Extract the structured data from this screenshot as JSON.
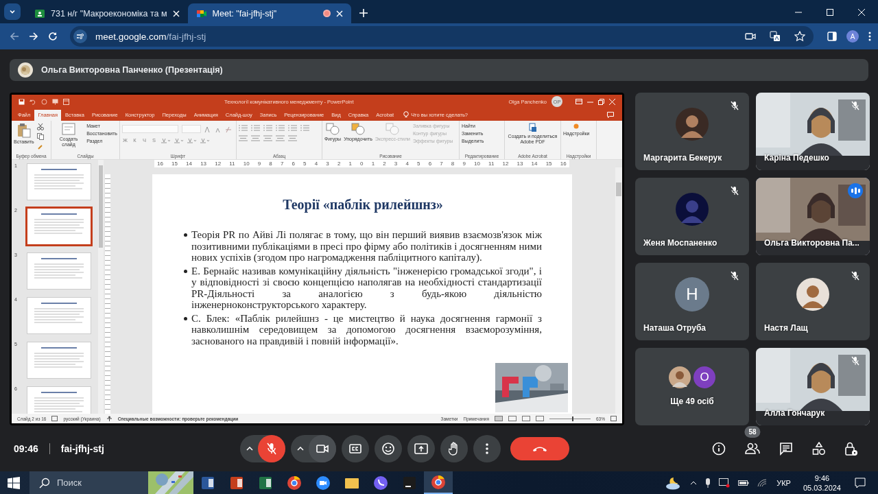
{
  "browser": {
    "tabs": [
      {
        "title": "731 н/г \"Макроекономіка та м",
        "kind": "classroom",
        "selected": false,
        "recording": false
      },
      {
        "title": "Meet: \"fai-jfhj-stj\"",
        "kind": "meet",
        "selected": true,
        "recording": true
      }
    ],
    "address": {
      "host": "meet.google.com",
      "path": "/fai-jfhj-stj"
    },
    "profile": "A"
  },
  "presenter": {
    "name": "Ольга Викторовна Панченко (Презентація)"
  },
  "powerpoint": {
    "title": "Технології комунікативного менеджменту - PowerPoint",
    "user": "Olga Panchenko",
    "user_initials": "OP",
    "tabs": [
      {
        "label": "Файл",
        "selected": false
      },
      {
        "label": "Главная",
        "selected": true
      },
      {
        "label": "Вставка",
        "selected": false
      },
      {
        "label": "Рисование",
        "selected": false
      },
      {
        "label": "Конструктор",
        "selected": false
      },
      {
        "label": "Переходы",
        "selected": false
      },
      {
        "label": "Анимация",
        "selected": false
      },
      {
        "label": "Слайд-шоу",
        "selected": false
      },
      {
        "label": "Запись",
        "selected": false
      },
      {
        "label": "Рецензирование",
        "selected": false
      },
      {
        "label": "Вид",
        "selected": false
      },
      {
        "label": "Справка",
        "selected": false
      },
      {
        "label": "Acrobat",
        "selected": false
      }
    ],
    "tell_me": "Что вы хотите сделать?",
    "clipboard": {
      "label": "Буфер обмена",
      "paste": "Вставить"
    },
    "slides": {
      "label": "Слайды",
      "new_slide": "Создать слайд",
      "items": [
        "Макет",
        "Восстановить",
        "Раздел"
      ]
    },
    "font": {
      "label": "Шрифт",
      "buttons": [
        "Ж",
        "К",
        "Ч",
        "S"
      ]
    },
    "paragraph": {
      "label": "Абзац"
    },
    "drawing": {
      "label": "Рисование",
      "big": [
        {
          "label": "Фигуры",
          "disabled": false
        },
        {
          "label": "Упорядочить",
          "disabled": false
        },
        {
          "label": "Экспресс-стили",
          "disabled": true
        }
      ],
      "items": [
        {
          "label": "Заливка фигуры",
          "disabled": true
        },
        {
          "label": "Контур фигуры",
          "disabled": true
        },
        {
          "label": "Эффекты фигуры",
          "disabled": true
        }
      ]
    },
    "editing": {
      "label": "Редактирование",
      "items": [
        "Найти",
        "Заменить",
        "Выделить"
      ]
    },
    "acrobat": {
      "label": "Adobe Acrobat",
      "button": "Создать и поделиться Adobe PDF"
    },
    "addins": {
      "label": "Надстройки",
      "button": "Надстройки"
    },
    "ruler": [
      "16",
      "15",
      "14",
      "13",
      "12",
      "11",
      "10",
      "9",
      "8",
      "7",
      "6",
      "5",
      "4",
      "3",
      "2",
      "1",
      "0",
      "1",
      "2",
      "3",
      "4",
      "5",
      "6",
      "7",
      "8",
      "9",
      "10",
      "11",
      "12",
      "13",
      "14",
      "15",
      "16"
    ],
    "thumbnails": [
      {
        "number": "1",
        "selected": false
      },
      {
        "number": "2",
        "selected": true
      },
      {
        "number": "3",
        "selected": false
      },
      {
        "number": "4",
        "selected": false
      },
      {
        "number": "5",
        "selected": false
      },
      {
        "number": "6",
        "selected": false
      }
    ],
    "slide": {
      "title": "Теорії «паблік рилейшнз»",
      "bullets": [
        "Теорія PR по Айві Лі полягає в тому, що він перший виявив взаємозв'язок між позитивними публікаціями в пресі про фірму або політиків і досягненням ними нових успіхів (згодом про нагромадження пабліцитного капіталу).",
        "Е. Бернайс називав комунікаційну діяльність \"інженерією громадської згоди\", і у відповідності зі своєю концепцією наполягав на необхідності стандартизації PR-Діяльності за аналогією з будь-якою діяльністю інженерноконструкторського характеру.",
        "С. Блек: «Паблік рилейшнз - це мистецтво й наука досягнення гармонії з навколишнім середовищем за допомогою досягнення взаєморозуміння, заснованого на правдивій і повній інформації»."
      ]
    },
    "status": {
      "slide": "Слайд 2 из 16",
      "language": "русский (Украина)",
      "accessibility": "Специальные возможности: проверьте рекомендации",
      "notes": "Заметки",
      "comments": "Примечания",
      "zoom": "63%",
      "level": 0.55
    }
  },
  "participants": [
    {
      "name": "Маргарита Бекерук",
      "kind": "avatar",
      "muted": true,
      "speaking": false
    },
    {
      "name": "Каріна Педешко",
      "kind": "video",
      "muted": true,
      "speaking": false
    },
    {
      "name": "Женя Моспаненко",
      "kind": "avatar",
      "muted": true,
      "speaking": false
    },
    {
      "name": "Ольга Викторовна Па...",
      "kind": "video",
      "muted": false,
      "speaking": true
    },
    {
      "name": "Наташа Отруба",
      "kind": "letter",
      "initial": "Н",
      "muted": true,
      "speaking": false
    },
    {
      "name": "Настя Лащ",
      "kind": "avatar",
      "muted": true,
      "speaking": false
    },
    {
      "name": "Ще 49 осіб",
      "kind": "more",
      "initial": "О"
    },
    {
      "name": "Алла Гончарук",
      "kind": "video",
      "muted": true,
      "speaking": false
    }
  ],
  "meeting": {
    "time": "09:46",
    "code": "fai-jfhj-stj",
    "mic_muted": true,
    "people_count": "58"
  },
  "taskbar": {
    "search": "Поиск",
    "apps": [
      {
        "kind": "word",
        "active": false
      },
      {
        "kind": "powerpoint",
        "active": false
      },
      {
        "kind": "excel",
        "active": false
      },
      {
        "kind": "chrome",
        "active": false
      },
      {
        "kind": "zoom",
        "active": false
      },
      {
        "kind": "explorer",
        "active": false
      },
      {
        "kind": "viber",
        "active": false
      },
      {
        "kind": "intellij",
        "active": false
      },
      {
        "kind": "chrome",
        "active": true
      }
    ],
    "language": "УКР",
    "time": "9:46",
    "date": "05.03.2024"
  }
}
